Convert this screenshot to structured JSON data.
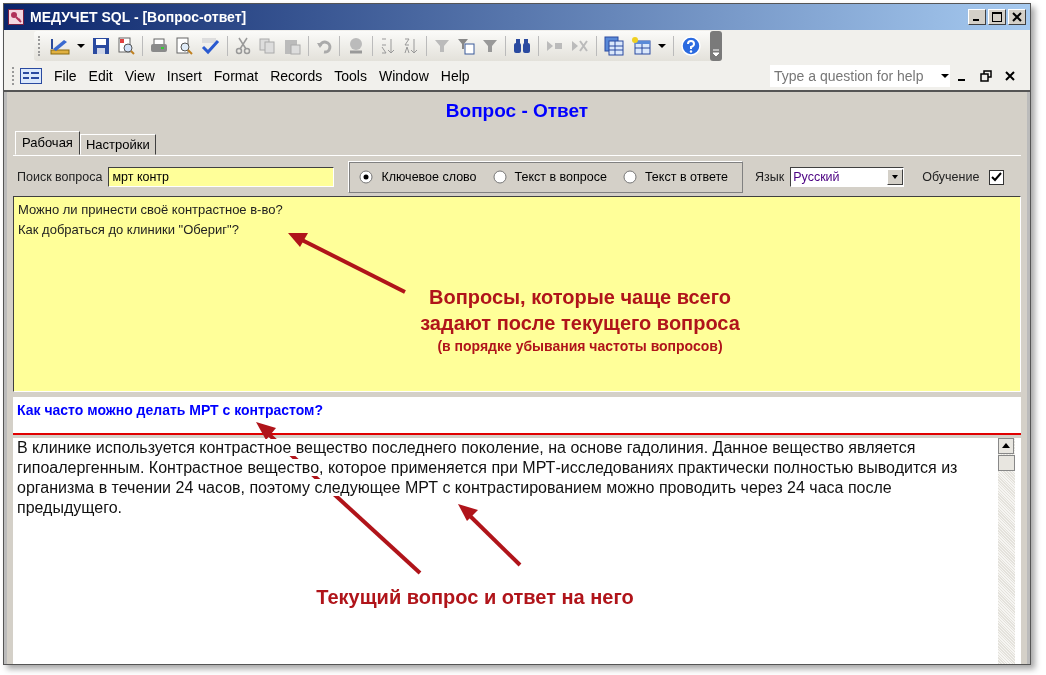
{
  "window": {
    "title": "МЕДУЧЕТ SQL - [Вопрос-ответ]"
  },
  "menu": [
    {
      "label": "File"
    },
    {
      "label": "Edit"
    },
    {
      "label": "View"
    },
    {
      "label": "Insert"
    },
    {
      "label": "Format"
    },
    {
      "label": "Records"
    },
    {
      "label": "Tools"
    },
    {
      "label": "Window"
    },
    {
      "label": "Help"
    }
  ],
  "help_box": {
    "placeholder": "Type a question for help"
  },
  "form": {
    "title": "Вопрос - Ответ"
  },
  "tabs": [
    {
      "label": "Рабочая",
      "selected": true
    },
    {
      "label": "Настройки",
      "selected": false
    }
  ],
  "search": {
    "label": "Поиск вопроса",
    "value": "мрт контр"
  },
  "search_modes": [
    {
      "label": "Ключевое слово",
      "selected": true
    },
    {
      "label": "Текст в вопросе",
      "selected": false
    },
    {
      "label": "Текст в ответе",
      "selected": false
    }
  ],
  "language": {
    "label": "Язык",
    "value": "Русский"
  },
  "training": {
    "label": "Обучение",
    "checked": true
  },
  "suggested_questions": [
    "Можно ли принести своё контрастное в-во?",
    "Как добраться до клиники \"Обериг\"?"
  ],
  "current_question": "Как часто можно делать МРТ с контрастом?",
  "answer": "В клинике используется контрастное вещество последнего поколение, на основе гадолиния. Данное вещество является гипоалергенным. Контрастное вещество, которое применяется при МРТ-исследованиях практически полностью выводится из организма в течении 24 часов, поэтому следующее МРТ с контрастированием можно проводить через 24 часа после предыдущего.",
  "annotations": [
    {
      "lines": [
        "Вопросы, которые чаще всего",
        "задают после текущего вопроса"
      ],
      "note": "(в порядке убывания частоты вопросов)"
    },
    {
      "lines": [
        "Текущий вопрос и ответ на него"
      ]
    }
  ]
}
